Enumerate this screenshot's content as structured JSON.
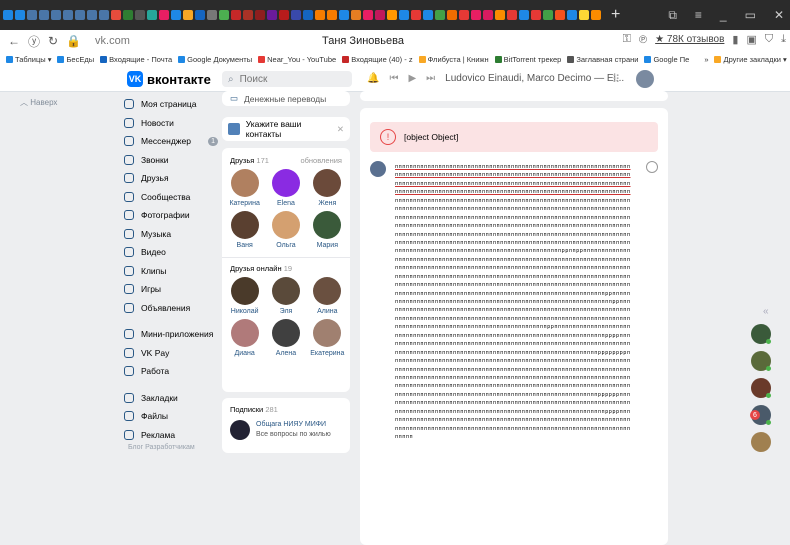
{
  "browser": {
    "tab_colors": [
      "#1e88e5",
      "#1e88e5",
      "#4a76a8",
      "#4a76a8",
      "#4a76a8",
      "#4a76a8",
      "#4a76a8",
      "#4a76a8",
      "#4a76a8",
      "#e74c3c",
      "#2e7d32",
      "#555",
      "#26a69a",
      "#e91e63",
      "#1e88e5",
      "#f9a825",
      "#1565c0",
      "#777",
      "#4caf50",
      "#c62828",
      "#a93226",
      "#8e1e1e",
      "#6a1b9a",
      "#b71c1c",
      "#3949ab",
      "#1565c0",
      "#f57c00",
      "#f57c00",
      "#1e88e5",
      "#e67e22",
      "#e91e63",
      "#c2185b",
      "#ff9800",
      "#1e88e5",
      "#e53935",
      "#1e88e5",
      "#43a047",
      "#ef6c00",
      "#e53935",
      "#e91e63",
      "#d81b60",
      "#fb8c00",
      "#e53935",
      "#1e88e5",
      "#e53935",
      "#43a047",
      "#f4511e",
      "#1e88e5",
      "#fdd835",
      "#fb8c00"
    ],
    "new_tab": "+",
    "window_controls": [
      "⧉",
      "≡",
      "_",
      "▭",
      "✕"
    ],
    "url": "vk.com",
    "page_title": "Таня Зиновьева",
    "review_button": "★ 78К отзывов",
    "bookmarks": [
      {
        "label": "Таблицы ▾",
        "color": "#1e88e5"
      },
      {
        "label": "БесЕды",
        "color": "#1e88e5"
      },
      {
        "label": "Входящие - Почта",
        "color": "#1565c0"
      },
      {
        "label": "Google Документы",
        "color": "#1e88e5"
      },
      {
        "label": "Near_You - YouTube",
        "color": "#e53935"
      },
      {
        "label": "Входящие (40) - z",
        "color": "#c62828"
      },
      {
        "label": "Флибуста | Книжн",
        "color": "#f9a825"
      },
      {
        "label": "BitTorrent трекер",
        "color": "#2e7d32"
      },
      {
        "label": "Заглавная страни",
        "color": "#555"
      },
      {
        "label": "Google Пе",
        "color": "#1e88e5"
      },
      {
        "label": "»",
        "color": "#fff"
      },
      {
        "label": "Другие закладки ▾",
        "color": "#f9a825"
      }
    ]
  },
  "vk": {
    "logo": "вконтакте",
    "logo_mark": "VK",
    "search_placeholder": "Поиск",
    "player_track": "Ludovico Einaudi, Marco Decimo — Ei...",
    "back_label": "Наверх",
    "menu": [
      {
        "label": "Моя страница"
      },
      {
        "label": "Новости"
      },
      {
        "label": "Мессенджер",
        "badge": "1"
      },
      {
        "label": "Звонки"
      },
      {
        "label": "Друзья"
      },
      {
        "label": "Сообщества"
      },
      {
        "label": "Фотографии"
      },
      {
        "label": "Музыка"
      },
      {
        "label": "Видео"
      },
      {
        "label": "Клипы"
      },
      {
        "label": "Игры"
      },
      {
        "label": "Объявления"
      },
      {
        "divider": true
      },
      {
        "label": "Мини-приложения"
      },
      {
        "label": "VK Pay"
      },
      {
        "label": "Работа"
      },
      {
        "divider": true
      },
      {
        "label": "Закладки"
      },
      {
        "label": "Файлы"
      },
      {
        "label": "Реклама"
      }
    ],
    "footer_text": "Блог   Разработчикам"
  },
  "middle": {
    "money_transfers": "Денежные переводы",
    "contacts_prompt": "Укажите ваши контакты",
    "friends_title": "Друзья",
    "friends_count": "171",
    "friends_updates": "обновления",
    "friends": [
      {
        "name": "Катерина",
        "color": "#b08060"
      },
      {
        "name": "Elena",
        "color": "#8a2be2"
      },
      {
        "name": "Женя",
        "color": "#6b4a3a"
      },
      {
        "name": "Ваня",
        "color": "#5a4030"
      },
      {
        "name": "Ольга",
        "color": "#d4a070"
      },
      {
        "name": "Мария",
        "color": "#3a5a3a"
      }
    ],
    "online_title": "Друзья онлайн",
    "online_count": "19",
    "online": [
      {
        "name": "Николай",
        "color": "#4a3a2a"
      },
      {
        "name": "Эля",
        "color": "#5a4a3a"
      },
      {
        "name": "Алина",
        "color": "#6a5040"
      },
      {
        "name": "Диана",
        "color": "#b07a7a"
      },
      {
        "name": "Алена",
        "color": "#404040"
      },
      {
        "name": "Екатерина",
        "color": "#a08070"
      }
    ],
    "subs_title": "Подписки",
    "subs_count": "281",
    "sub1_name": "Общага НИЯУ МИФИ",
    "sub1_desc": "Все вопросы по жилью"
  },
  "main": {
    "error_message": "[object Object]",
    "post_lines": [
      "ппппппппппппппппппппппппппппппппппппппппппппппппппппппппппппппппп",
      "ппппппппппппппппппппппппппппппппппппппппппппппппппппппппппппппппп",
      "ппппппппппппппппппппппппппппппппппппппппппппппппппппппппппппппппп",
      "ппппппппппппппппппппппппппппппппппппппппппппппппппппппппппппппппп",
      "ппппппппппппппппппппппппппппппппппппппппппппппппппппппппппппппппп",
      "ппппппппппппппппппппппппппппппппппппппппппппппппппппппппппппппппп",
      "ппппппппппппппппппппппппппппппппппппппппппппппппппппппппппппппппп",
      "ппппппппппппппппппппппппппппппппппппппппппппппппппппппппппппппппп",
      "ппппппппппппппппппппппппппппппппппппппппппппппппппппппппппппппппп",
      "ппппппппппппппппппппппппппппппппппппппппппппппппппппппппппппппппп",
      "ппппппппппппппппппппппппппппппппппппппппппппппppппppппппппппппппп",
      "ппппппппппппппппппппппппппппппппппппппппппппппппппппппппппппппппп",
      "ппппппппппппппппппппппппппппппппппппппппппппппппппппппппппппппппп",
      "ппппппппппппппппппппппппппппппппппппппппппппппппппппппппппппппппп",
      "ппппппппппппппппппппппппппппппппппппппппппппппппппппппппппппппппп",
      "ппппппппппппппппппппппппппппппппппппппппппппппппппппппппппppппппп",
      "ппппппппппппппппппппппппппппппппппппппппппппппппппппппппппппppппп",
      "ппппппппппппппппппппппппппппппппппппппппппппппппппппппппппппппппп",
      "ппппппппппппппппппппппппппппппппппппппппппппппппппппппппппппппппп",
      "ппппппппппппппппппппппппппппппппппппппппппppппппппппппппппппппппп",
      "ппппппппппппппппппппппппппппппппппппппппппппппппппппппппппppppппп",
      "ппппппппппппппппппппппппппппппппппппппппппппппппппппппппппппппппп",
      "ппппппппппппппппппппппппппппппппппппппппппппппппппппппппppppppppп",
      "ппппппппппппппппппппппппппппппппппппппппппппппппппппппппппппппппп",
      "ппппппппппппппппппппппппппппппппппппппппппппппппппппппппппппппппп",
      "ппппппппппппппппппппппппппппппппппппппппппппппппппппппппппппппппп",
      "ппппппппппппппппппппппппппппппппппппппппппппппппппппппппппппппппп",
      "ппппппппппппппппппппппппппппппппппппппппппппппппппппппппppppppппп",
      "ппппппппппппппппппппппппппппппппппппппппппппппппппппппппппппппппп",
      "ппппппппппппппппппппппппппппппппппппппппппппппппппппппппппppppппп",
      "ппппппппппппппппппппппппппппппппппппппппппппппппппппппппппппппппп",
      "ппппппппппппппппппппппппппппппппппппппппппппппппппппппппппппппппп",
      "ппппп"
    ]
  },
  "right_rail": {
    "collapse": "«",
    "avatars": [
      {
        "color": "#3a5a3a"
      },
      {
        "color": "#5a6a3a"
      },
      {
        "color": "#6a3a2a"
      },
      {
        "color": "#4a5a6a"
      },
      {
        "color": "#a08050"
      }
    ],
    "badge": "6"
  }
}
